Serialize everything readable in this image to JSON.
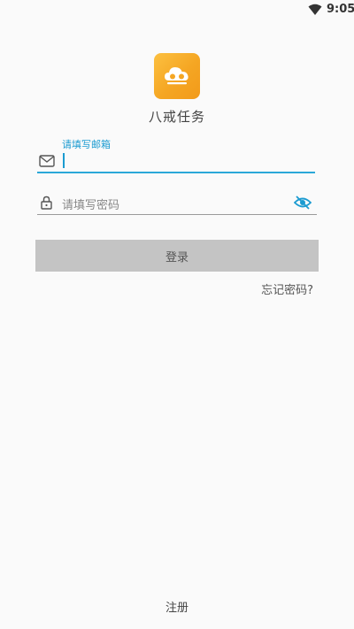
{
  "status_bar": {
    "time": "9:05",
    "wifi_icon": "wifi-icon"
  },
  "app": {
    "name": "八戒任务",
    "logo_icon": "cloud-icon",
    "logo_color": "#f5a623"
  },
  "email": {
    "label": "请填写邮箱",
    "value": "",
    "icon": "mail-icon",
    "accent_color": "#2aa8d8"
  },
  "password": {
    "placeholder": "请填写密码",
    "icon": "lock-icon",
    "visibility_icon": "eye-off-icon",
    "visibility_color": "#1b9bd1"
  },
  "login_button": {
    "label": "登录",
    "color": "#c4c4c4"
  },
  "forgot_password": {
    "label": "忘记密码?"
  },
  "register": {
    "label": "注册"
  }
}
